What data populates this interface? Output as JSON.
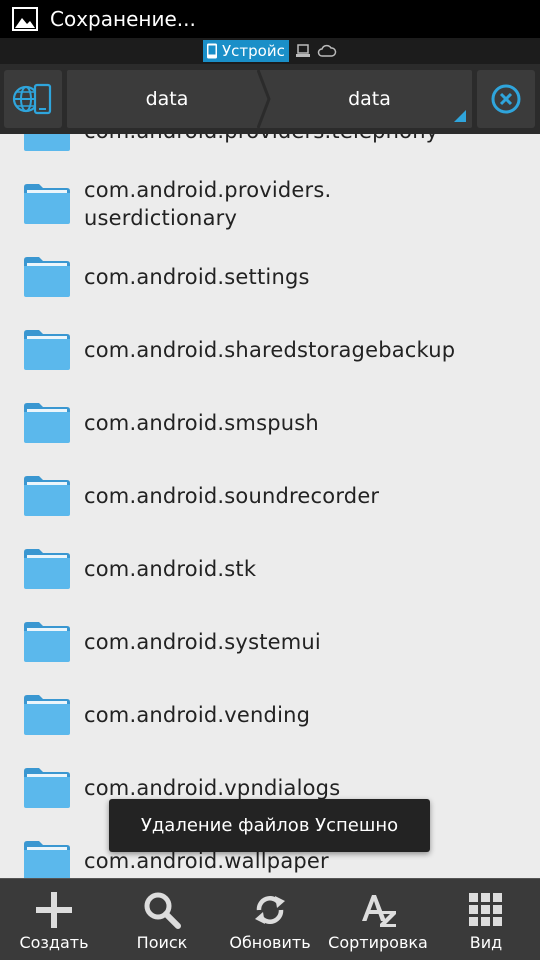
{
  "status_bar": {
    "title": "Сохранение...",
    "icon": "image-icon"
  },
  "storage_tabs": {
    "device_label": "Устройс",
    "icons": [
      "phone-icon",
      "computer-icon",
      "cloud-icon"
    ]
  },
  "path_bar": {
    "crumbs": [
      "data",
      "data"
    ],
    "left_icon": "network-device-icon",
    "right_icon": "close-circle-icon"
  },
  "files": [
    {
      "name": "com.android.providers.telephony"
    },
    {
      "name": "com.android.providers.\nuserdictionary"
    },
    {
      "name": "com.android.settings"
    },
    {
      "name": "com.android.sharedstoragebackup"
    },
    {
      "name": "com.android.smspush"
    },
    {
      "name": "com.android.soundrecorder"
    },
    {
      "name": "com.android.stk"
    },
    {
      "name": "com.android.systemui"
    },
    {
      "name": "com.android.vending"
    },
    {
      "name": "com.android.vpndialogs"
    },
    {
      "name": "com.android.wallpaper"
    }
  ],
  "toast": {
    "message": "Удаление файлов Успешно"
  },
  "toolbar": {
    "create_label": "Создать",
    "search_label": "Поиск",
    "refresh_label": "Обновить",
    "sort_label": "Сортировка",
    "view_label": "Вид"
  },
  "colors": {
    "accent": "#2fa5dc",
    "folder": "#5bb8ec",
    "folder_dark": "#3a97d1"
  }
}
